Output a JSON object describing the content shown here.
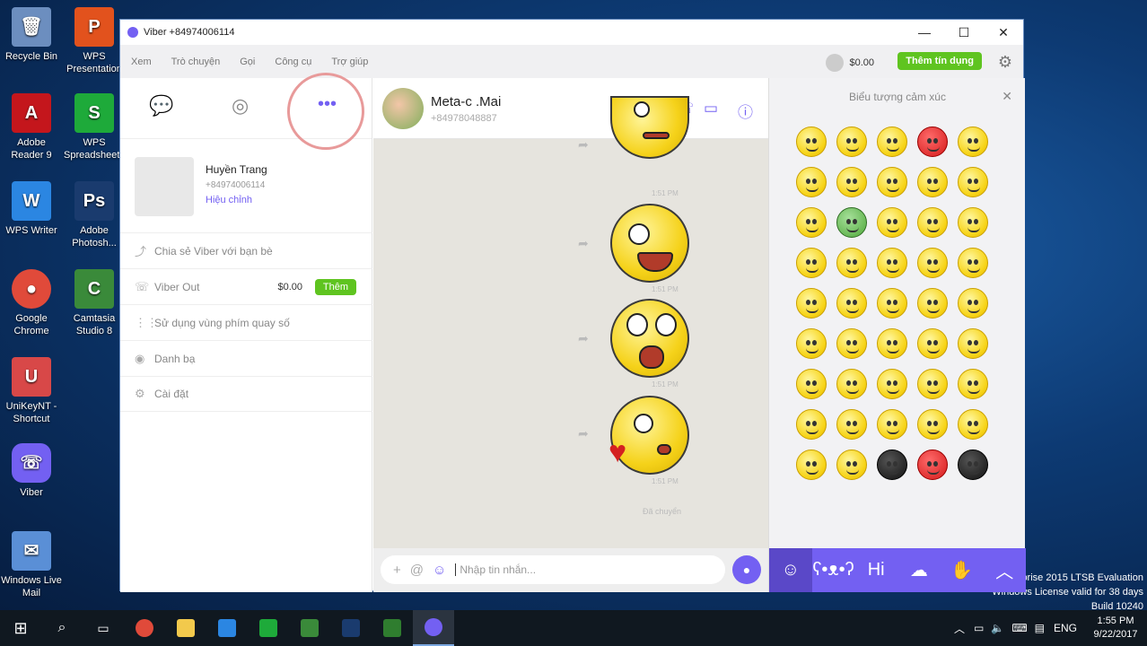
{
  "desktop": {
    "icons": [
      {
        "label": "Recycle Bin",
        "color": "#6c8ebf"
      },
      {
        "label": "WPS Presentation",
        "color": "#e2521d"
      },
      {
        "label": "Adobe Reader 9",
        "color": "#c4161c"
      },
      {
        "label": "WPS Spreadsheets",
        "color": "#1eaa3a"
      },
      {
        "label": "WPS Writer",
        "color": "#2b86e2"
      },
      {
        "label": "Adobe Photosh...",
        "color": "#1a3b6e"
      },
      {
        "label": "Google Chrome",
        "color": "#e04a3a"
      },
      {
        "label": "Camtasia Studio 8",
        "color": "#3a8a3a"
      },
      {
        "label": "UniKeyNT - Shortcut",
        "color": "#d84848"
      },
      {
        "label": "Viber",
        "color": "#7360f2"
      },
      {
        "label": "Windows Live Mail",
        "color": "#5a8fd6"
      }
    ],
    "watermark": {
      "line1": "rprise 2015 LTSB Evaluation",
      "line2": "Windows License valid for 38 days",
      "line3": "Build 10240"
    }
  },
  "window": {
    "title": "Viber +84974006114",
    "menu": [
      "Xem",
      "Trò chuyện",
      "Gọi",
      "Công cụ",
      "Trợ giúp"
    ],
    "balance": "$0.00",
    "topup_label": "Thêm tín dụng"
  },
  "profile": {
    "name": "Huyền Trang",
    "phone": "+84974006114",
    "edit_label": "Hiệu chỉnh"
  },
  "menu_items": {
    "share": "Chia sẻ Viber với bạn bè",
    "viber_out": "Viber Out",
    "viber_out_balance": "$0.00",
    "viber_out_button": "Thêm",
    "dialpad": "Sử dụng vùng phím quay số",
    "contacts": "Danh bạ",
    "settings": "Cài đặt"
  },
  "chat": {
    "name": "Meta-c .Mai",
    "phone": "+84978048887",
    "time": "1:51 PM",
    "seen": "Đã chuyển",
    "input_placeholder": "Nhập tin nhắn..."
  },
  "emoji_panel": {
    "title": "Biểu tượng cảm xúc"
  },
  "taskbar": {
    "lang": "ENG",
    "time": "1:55 PM",
    "date": "9/22/2017"
  }
}
